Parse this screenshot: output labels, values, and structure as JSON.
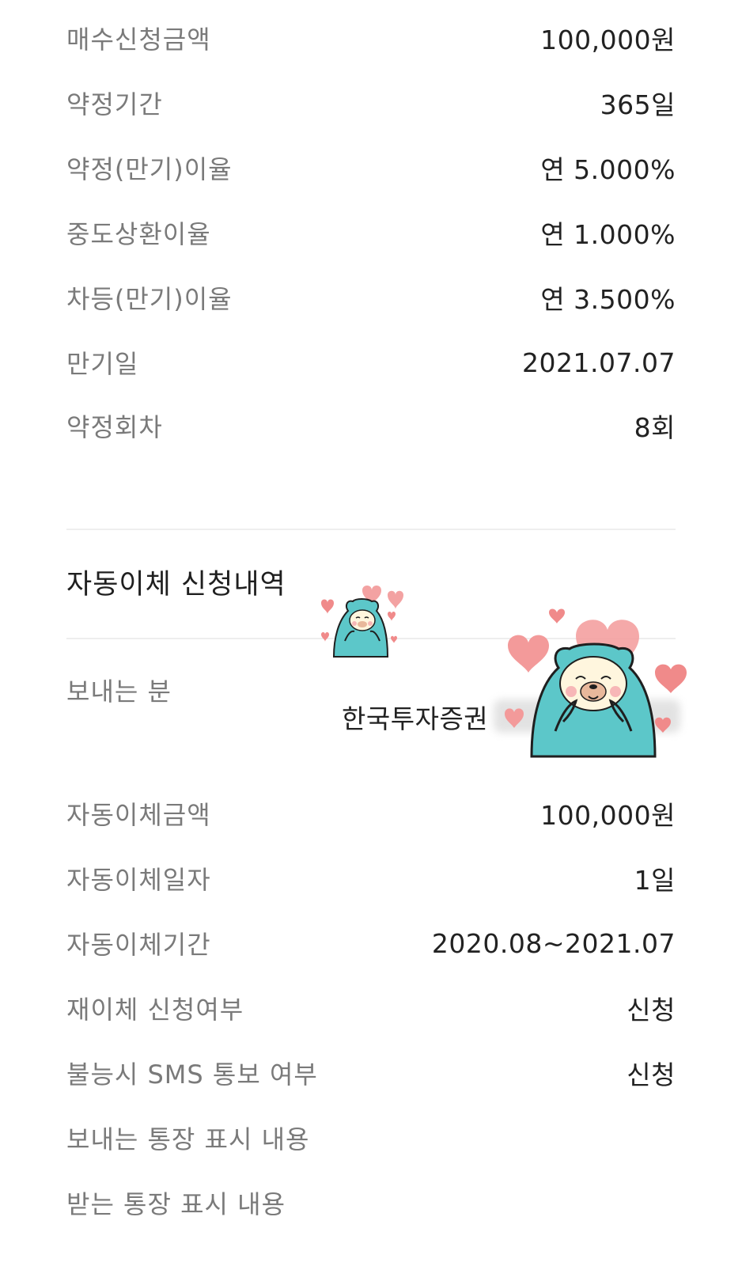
{
  "contract_details": [
    {
      "label": "매수신청금액",
      "value": "100,000원"
    },
    {
      "label": "약정기간",
      "value": "365일"
    },
    {
      "label": "약정(만기)이율",
      "value": "연 5.000%"
    },
    {
      "label": "중도상환이율",
      "value": "연 1.000%"
    },
    {
      "label": "차등(만기)이율",
      "value": "연 3.500%"
    },
    {
      "label": "만기일",
      "value": "2021.07.07"
    },
    {
      "label": "약정회차",
      "value": "8회"
    }
  ],
  "auto_transfer": {
    "title": "자동이체 신청내역",
    "sender_label": "보내는 분",
    "sender_value": "한국투자증권",
    "rows": [
      {
        "label": "자동이체금액",
        "value": "100,000원"
      },
      {
        "label": "자동이체일자",
        "value": "1일"
      },
      {
        "label": "자동이체기간",
        "value": "2020.08~2021.07"
      },
      {
        "label": "재이체 신청여부",
        "value": "신청"
      },
      {
        "label": "불능시 SMS 통보 여부",
        "value": "신청"
      },
      {
        "label": "보내는 통장 표시 내용",
        "value": ""
      },
      {
        "label": "받는 통장 표시 내용",
        "value": ""
      }
    ]
  },
  "colors": {
    "label": "#7a7a7a",
    "value": "#222222",
    "divider": "#eeeeee",
    "bear": "#5cc7c9",
    "heart": "#f08a8a"
  },
  "stickers": [
    {
      "name": "small-bear-hearts-sticker",
      "icon": "bear-with-hearts"
    },
    {
      "name": "large-bear-hearts-sticker",
      "icon": "bear-with-hearts"
    }
  ]
}
